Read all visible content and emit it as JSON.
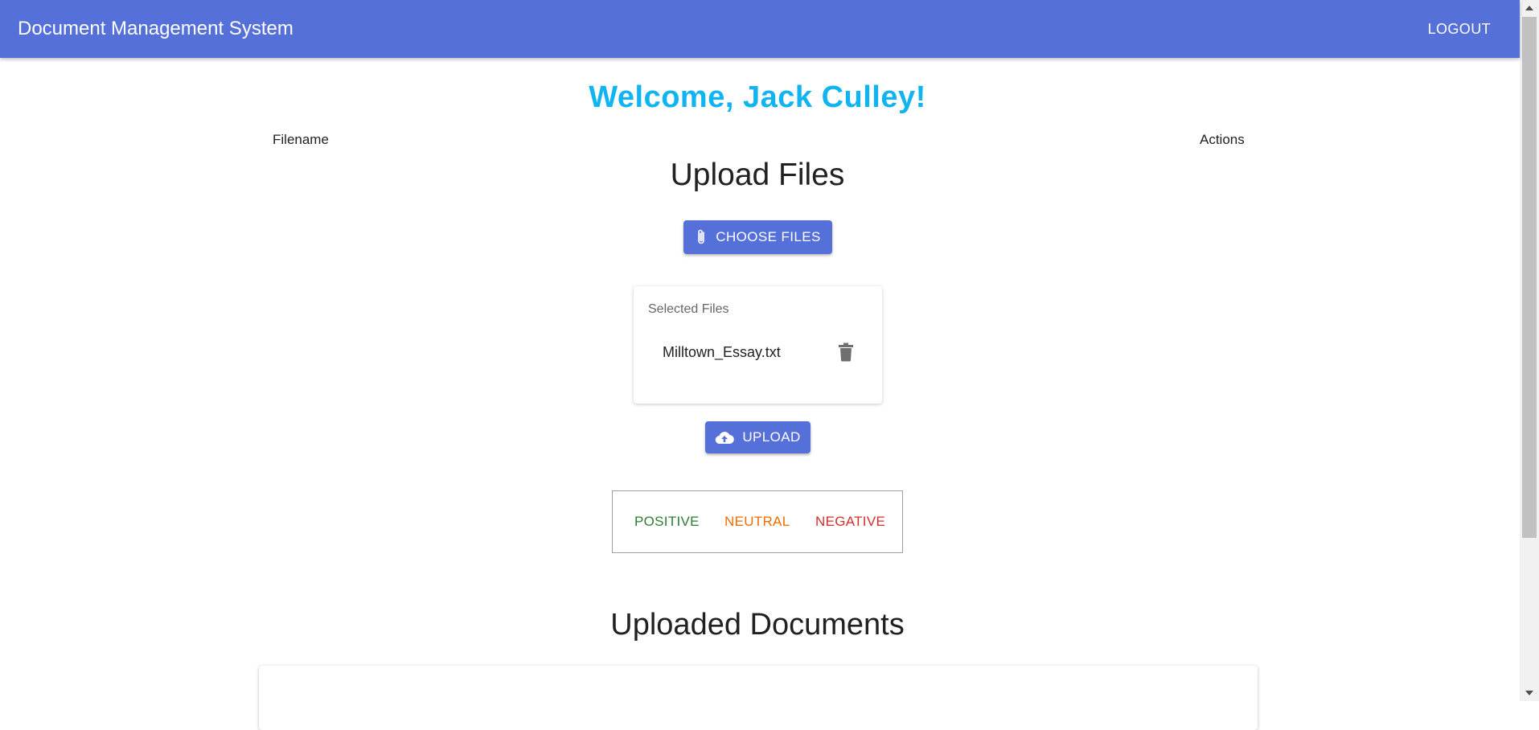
{
  "appbar": {
    "title": "Document Management System",
    "logout_label": "LOGOUT"
  },
  "welcome": "Welcome, Jack Culley!",
  "upload": {
    "title": "Upload Files",
    "choose_label": "CHOOSE FILES",
    "selected_label": "Selected Files",
    "files": [
      "Milltown_Essay.txt"
    ],
    "upload_label": "UPLOAD"
  },
  "sentiment": {
    "positive": "POSITIVE",
    "neutral": "NEUTRAL",
    "negative": "NEGATIVE"
  },
  "documents": {
    "title": "Uploaded Documents",
    "columns": [
      "Filename",
      "Actions"
    ]
  },
  "colors": {
    "primary": "#5570d8",
    "welcome": "#10b4f0",
    "positive": "#2e7d32",
    "neutral": "#ef6c00",
    "negative": "#d32f2f"
  },
  "icons": {
    "choose": "paperclip-icon",
    "delete": "trash-icon",
    "upload": "cloud-upload-icon"
  }
}
